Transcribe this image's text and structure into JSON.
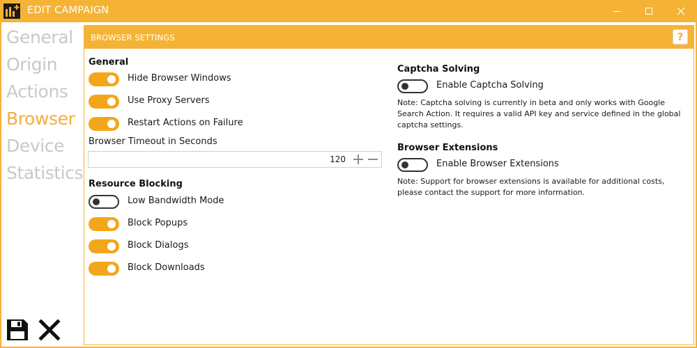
{
  "window": {
    "title": "EDIT CAMPAIGN",
    "accent_color": "#f5b335",
    "icons": {
      "app": "app-logo-icon",
      "minimize": "minimize-icon",
      "maximize": "maximize-icon",
      "close": "close-icon"
    }
  },
  "nav": {
    "items": [
      {
        "label": "General",
        "active": false
      },
      {
        "label": "Origin",
        "active": false
      },
      {
        "label": "Actions",
        "active": false
      },
      {
        "label": "Browser",
        "active": true
      },
      {
        "label": "Device",
        "active": false
      },
      {
        "label": "Statistics",
        "active": false
      }
    ],
    "active_color": "#f2ae3b",
    "inactive_color": "#c8c8c8",
    "actions": {
      "save_icon": "floppy-disk-icon",
      "cancel_icon": "x-icon"
    }
  },
  "panel": {
    "title": "BROWSER SETTINGS",
    "help_label": "?"
  },
  "general": {
    "title": "General",
    "toggles": [
      {
        "label": "Hide Browser Windows",
        "on": true
      },
      {
        "label": "Use Proxy Servers",
        "on": true
      },
      {
        "label": "Restart Actions on Failure",
        "on": true
      }
    ],
    "timeout": {
      "label": "Browser Timeout in Seconds",
      "value": "120",
      "increment_icon": "plus-icon",
      "decrement_icon": "minus-icon"
    }
  },
  "resource_blocking": {
    "title": "Resource Blocking",
    "toggles": [
      {
        "label": "Low Bandwidth Mode",
        "on": false
      },
      {
        "label": "Block Popups",
        "on": true
      },
      {
        "label": "Block Dialogs",
        "on": true
      },
      {
        "label": "Block Downloads",
        "on": true
      }
    ]
  },
  "captcha": {
    "title": "Captcha Solving",
    "toggle": {
      "label": "Enable Captcha Solving",
      "on": false
    },
    "note": "Note: Captcha solving is currently in beta and only works with Google Search Action. It requires a valid API key and service defined in the global captcha settings."
  },
  "extensions": {
    "title": "Browser Extensions",
    "toggle": {
      "label": "Enable Browser Extensions",
      "on": false
    },
    "note": "Note: Support for browser extensions is available for additional costs, please contact the support for more information."
  }
}
